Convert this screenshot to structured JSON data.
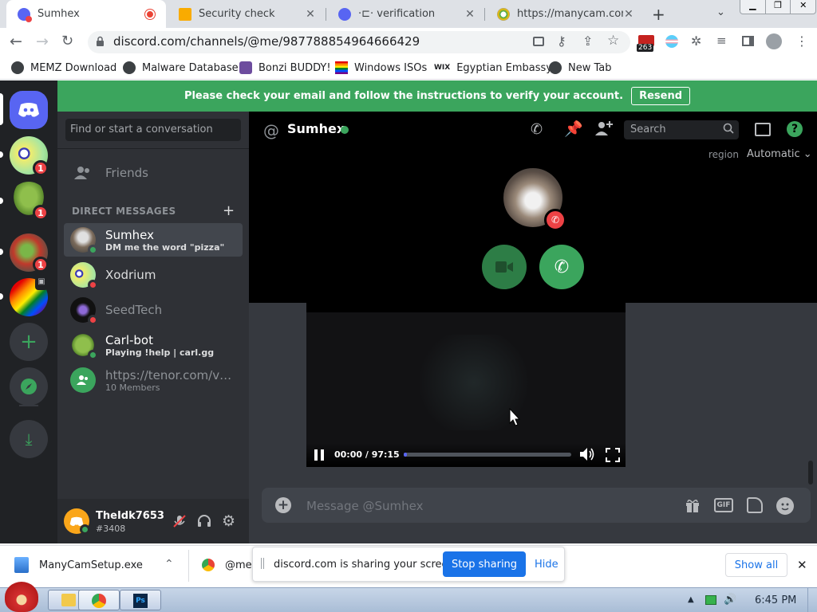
{
  "browser": {
    "tabs": [
      {
        "title": "Sumhex",
        "active": true
      },
      {
        "title": "Security check"
      },
      {
        "title": "·⊏· verification"
      },
      {
        "title": "https://manycam.com"
      }
    ],
    "url": "discord.com/channels/@me/987788854964666429",
    "ext_badge": "263",
    "bookmarks": [
      "MEMZ Download",
      "Malware Database",
      "Bonzi BUDDY!",
      "Windows ISOs",
      "Egyptian Embassy",
      "New Tab"
    ],
    "wix_label": "WIX"
  },
  "discord": {
    "banner_text": "Please check your email and follow the instructions to verify your account.",
    "resend_label": "Resend",
    "search_placeholder": "Find or start a conversation",
    "friends_label": "Friends",
    "dm_header": "DIRECT MESSAGES",
    "dms": [
      {
        "name": "Sumhex",
        "sub": "DM me the word \"pizza\"",
        "status": "online"
      },
      {
        "name": "Xodrium",
        "sub": "",
        "status": "dnd"
      },
      {
        "name": "SeedTech",
        "sub": "",
        "status": "dnd"
      },
      {
        "name": "Carl-bot",
        "sub": "Playing !help | carl.gg",
        "status": "online"
      },
      {
        "name": "https://tenor.com/vie...",
        "sub": "10 Members",
        "status": ""
      }
    ],
    "guild_badges": [
      "1",
      "1",
      "1"
    ],
    "user": {
      "name": "TheIdk7653",
      "tag": "#3408"
    },
    "channel": {
      "name": "Sumhex",
      "search_placeholder": "Search"
    },
    "region_label": "region",
    "region_value": "Automatic",
    "video": {
      "time": "00:00 / 97:15",
      "progress": 0.02
    },
    "message_placeholder": "Message @Sumhex",
    "gif_label": "GIF"
  },
  "download_bar": {
    "file": "ManyCamSetup.exe",
    "partial": "@me",
    "share_text": "discord.com is sharing your screen.",
    "stop_label": "Stop sharing",
    "hide_label": "Hide",
    "show_all": "Show all"
  },
  "taskbar": {
    "time": "6:45 PM"
  },
  "colors": {
    "discord_green": "#3ba55d",
    "blurple": "#5865f2",
    "dnd_red": "#ed4245",
    "chrome_blue": "#1a73e8"
  }
}
